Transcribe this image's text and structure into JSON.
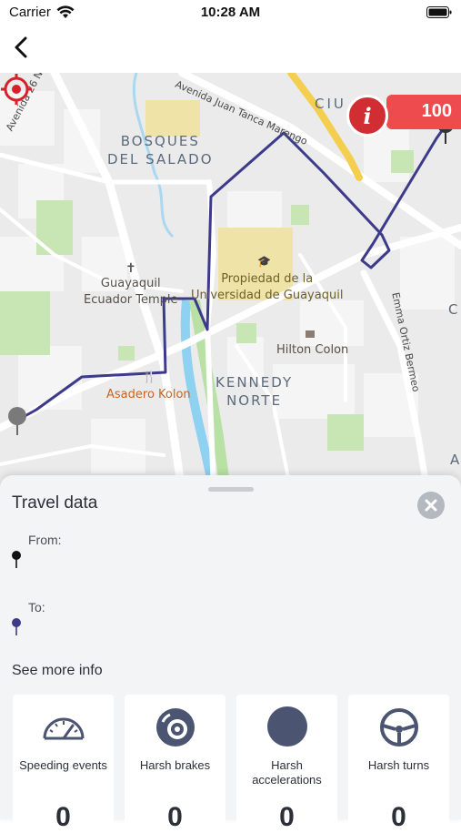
{
  "status_bar": {
    "carrier": "Carrier",
    "time": "10:28 AM"
  },
  "map": {
    "labels": {
      "bosques": "BOSQUES\nDEL SALADO",
      "kennedy": "KENNEDY\nNORTE",
      "temple": "Guayaquil\nEcuador Temple",
      "universidad": "Propiedad de la\nUniversidad de Guayaquil",
      "hilton": "Hilton Colon",
      "asadero": "Asadero Kolon",
      "juan_tanca": "Avenida Juan Tanca Marengo",
      "avenida_26": "Avenida 26 N",
      "emma": "Emma Ortiz Bermeo",
      "ciudad": "CIU",
      "edge_c": "C",
      "edge_a": "A"
    },
    "score": "100",
    "info_symbol": "i",
    "colors": {
      "route": "#3d3a8a",
      "badge": "#ee4b4e",
      "info": "#d02e33"
    }
  },
  "sheet": {
    "title": "Travel data",
    "from_label": "From:",
    "to_label": "To:",
    "see_more": "See more info",
    "cards": [
      {
        "label": "Speeding events",
        "value": "0",
        "icon": "speedometer-icon"
      },
      {
        "label": "Harsh brakes",
        "value": "0",
        "icon": "brake-disc-icon"
      },
      {
        "label": "Harsh accelerations",
        "value": "0",
        "icon": "acceleration-icon"
      },
      {
        "label": "Harsh turns",
        "value": "0",
        "icon": "steering-wheel-icon"
      }
    ]
  }
}
